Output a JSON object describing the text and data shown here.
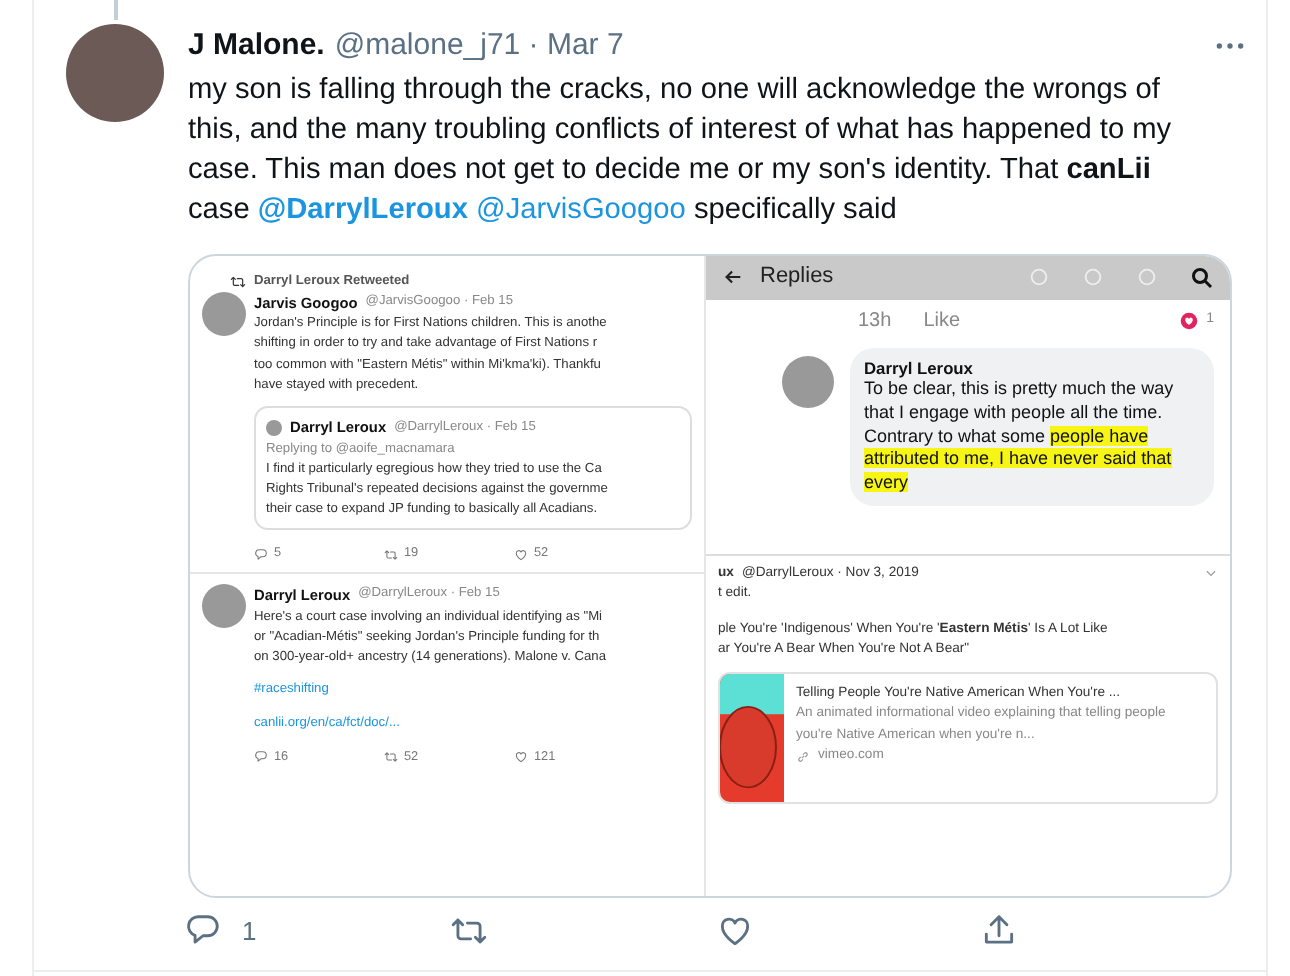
{
  "tweet": {
    "author": "J Malone.",
    "meta": "@malone_j71 · Mar 7",
    "text": [
      {
        "kind": "plain",
        "text": "my son is falling through the cracks, no one will acknowledge the wrongs of this, and the many troubling conflicts of interest of what has happened to my case. This man does not get to decide me or my son's identity. That "
      },
      {
        "kind": "bold",
        "text": "canLii"
      },
      {
        "kind": "plain",
        "text": " case "
      },
      {
        "kind": "mention",
        "text": "@DarrylLeroux",
        "bold": true
      },
      {
        "kind": "mention",
        "text": "@JarvisGoogoo",
        "bold": false
      },
      {
        "kind": "plain",
        "text": " specifically said"
      }
    ],
    "actions": [
      {
        "kind": "reply",
        "count": "1"
      },
      {
        "kind": "retweet"
      },
      {
        "kind": "like"
      },
      {
        "kind": "share"
      }
    ]
  },
  "image": {
    "left_panel": {
      "retweet_banner": "Darryl Leroux Retweeted",
      "tweets": [
        {
          "name": "Jarvis Googoo",
          "meta": "@JarvisGoogoo · Feb 15",
          "lines": [
            "Jordan's Principle is for First Nations children. This is anothe",
            "shifting in order to try and take advantage of First Nations r",
            "too common with \"Eastern Métis\" within Mi'kma'ki). Thankfu",
            "have stayed with precedent."
          ],
          "quote": {
            "name": "Darryl Leroux",
            "meta": "@DarrylLeroux · Feb 15",
            "reply_to": "Replying to @aoife_macnamara",
            "lines": [
              "I find it particularly egregious how they tried to use the Ca",
              "Rights Tribunal's repeated decisions against the governme",
              "their case to expand JP funding to basically all Acadians."
            ]
          },
          "actions": [
            {
              "kind": "reply",
              "count": "5"
            },
            {
              "kind": "retweet",
              "count": "19"
            },
            {
              "kind": "like",
              "count": "52"
            }
          ]
        },
        {
          "name": "Darryl Leroux",
          "meta": "@DarrylLeroux · Feb 15",
          "lines": [
            "Here's a court case involving an individual identifying as \"Mi",
            "or \"Acadian-Métis\" seeking Jordan's Principle funding for th",
            "on 300-year-old+ ancestry (14 generations). Malone v. Cana"
          ],
          "hashtag": "#raceshifting",
          "link": "canlii.org/en/ca/fct/doc/...",
          "actions": [
            {
              "kind": "reply",
              "count": "16"
            },
            {
              "kind": "retweet",
              "count": "52"
            },
            {
              "kind": "like",
              "count": "121"
            }
          ]
        }
      ]
    },
    "replies_panel": {
      "title": "Replies",
      "time": "13h",
      "like": "Like",
      "reaction_count": "1",
      "comment": {
        "name": "Darryl Leroux",
        "text": [
          {
            "text": "To be clear, this is pretty much the way that I engage with people all the time. Contrary to what some ",
            "highlight": false
          },
          {
            "text": "people have attributed to me, I have never said that every",
            "highlight": true
          }
        ]
      }
    },
    "tweet_panel": {
      "name": "ux",
      "meta": "@DarrylLeroux · Nov 3, 2019",
      "lines": [
        "t edit."
      ],
      "quote_lines": [
        "ple You're 'Indigenous' When You're '**Eastern Métis**' Is A Lot Like",
        "ar You're A Bear When You're Not A Bear\""
      ],
      "card": {
        "title": "Telling People You're Native American When You're ...",
        "description": "An animated informational video explaining that telling people you're Native American when you're n...",
        "domain": "vimeo.com"
      }
    }
  }
}
